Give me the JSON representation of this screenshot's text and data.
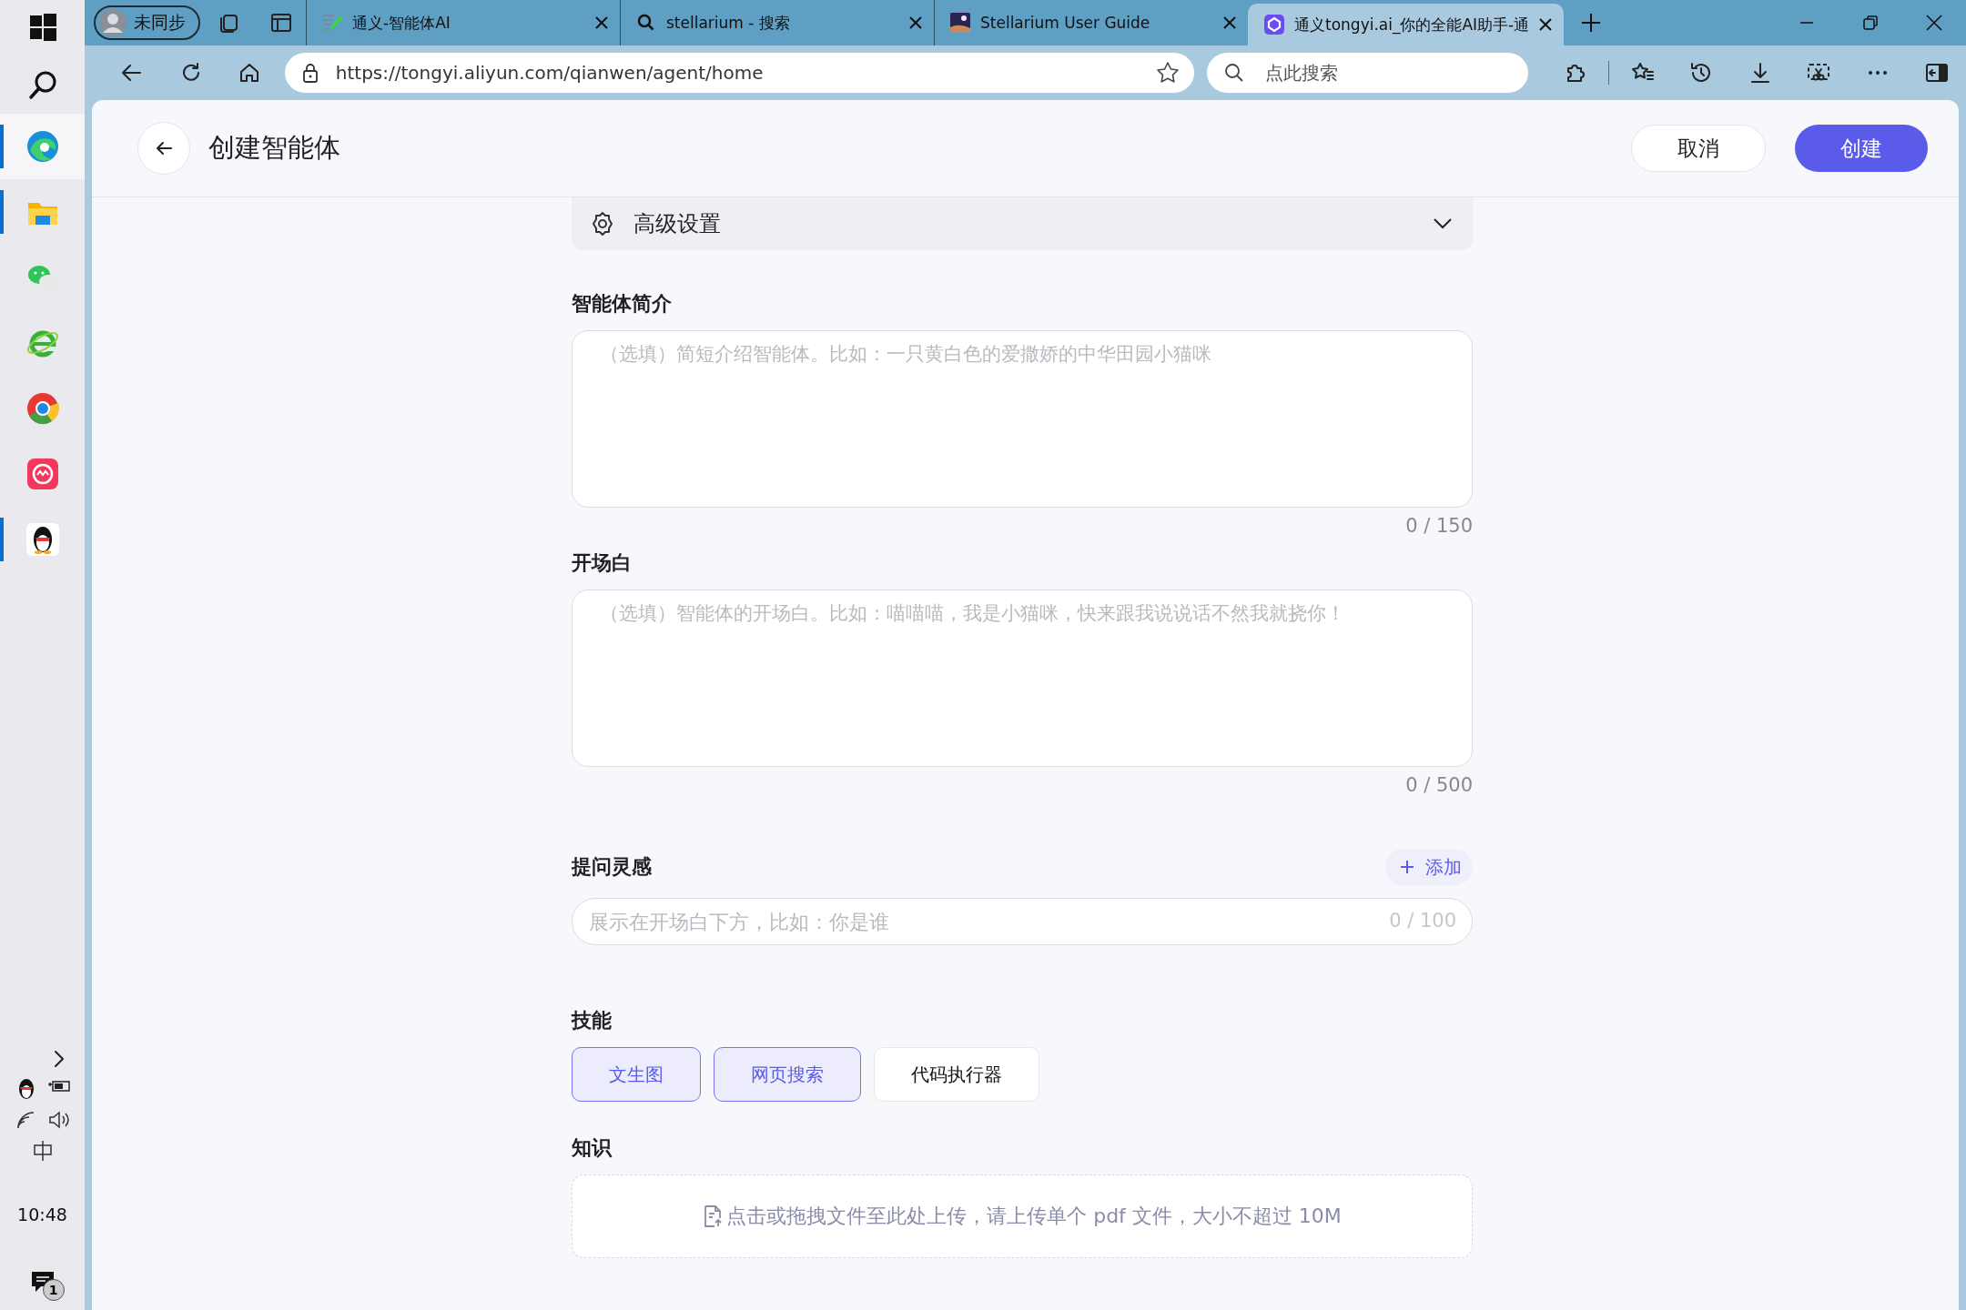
{
  "taskbar": {
    "apps": [
      {
        "kind": "edge",
        "running": true,
        "selected": true
      },
      {
        "kind": "folder",
        "running": true,
        "selected": false
      },
      {
        "kind": "chat",
        "running": false,
        "selected": false
      },
      {
        "kind": "ie",
        "running": false,
        "selected": false
      },
      {
        "kind": "chrome",
        "running": false,
        "selected": false
      },
      {
        "kind": "pink",
        "running": false,
        "selected": false
      },
      {
        "kind": "penguin",
        "running": true,
        "selected": false
      }
    ],
    "clock": "10:48",
    "notifications": "1"
  },
  "browser": {
    "profile": "未同步",
    "tabs": [
      {
        "kind": "feather",
        "title": "通义-智能体AI",
        "selected": false
      },
      {
        "kind": "search",
        "title": "stellarium - 搜索",
        "selected": false
      },
      {
        "kind": "night",
        "title": "Stellarium User Guide",
        "selected": false
      },
      {
        "kind": "tongyi",
        "title": "通义tongyi.ai_你的全能AI助手-通",
        "selected": true
      }
    ],
    "url": "https://tongyi.aliyun.com/qianwen/agent/home",
    "search_placeholder": "点此搜索"
  },
  "page": {
    "title": "创建智能体",
    "cancel": "取消",
    "create": "创建",
    "advanced": {
      "label": "高级设置",
      "expanded": false
    },
    "intro": {
      "label": "智能体简介",
      "placeholder": "（选填）简短介绍智能体。比如：一只黄白色的爱撒娇的中华田园小猫咪",
      "counter": "0 / 150"
    },
    "opening": {
      "label": "开场白",
      "placeholder": "（选填）智能体的开场白。比如：喵喵喵，我是小猫咪，快来跟我说说话不然我就挠你！",
      "counter": "0 / 500"
    },
    "prompts": {
      "label": "提问灵感",
      "add": "添加",
      "placeholder": "展示在开场白下方，比如：你是谁",
      "counter": "0 / 100"
    },
    "skills": {
      "label": "技能",
      "items": [
        {
          "label": "文生图",
          "selected": true
        },
        {
          "label": "网页搜索",
          "selected": true
        },
        {
          "label": "代码执行器",
          "selected": false
        }
      ]
    },
    "knowledge": {
      "label": "知识",
      "hint": "点击或拖拽文件至此处上传，请上传单个 pdf 文件，大小不超过 10M"
    }
  }
}
